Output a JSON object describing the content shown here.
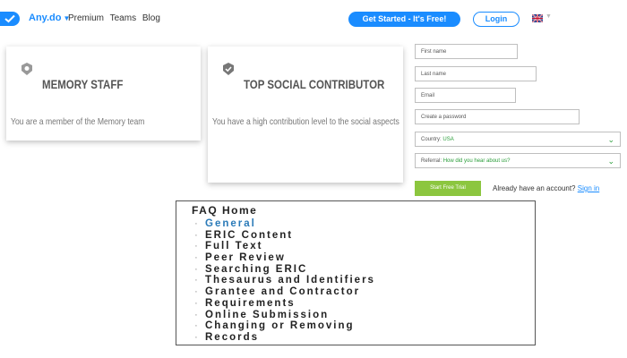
{
  "header": {
    "brand": "Any.do",
    "nav_links": [
      "Premium",
      "Teams",
      "Blog"
    ],
    "get_started_label": "Get Started - It's Free!",
    "login_label": "Login",
    "accent_color": "#1a8cff"
  },
  "badges": [
    {
      "icon": "brain-badge-icon",
      "title": "MEMORY STAFF",
      "description": "You are a member of the Memory team"
    },
    {
      "icon": "shield-check-icon",
      "title": "TOP SOCIAL CONTRIBUTOR",
      "description": "You have a high contribution level to the social aspects"
    }
  ],
  "signup": {
    "first_name_placeholder": "First name",
    "last_name_placeholder": "Last name",
    "email_placeholder": "Email",
    "password_placeholder": "Create a password",
    "country_label": "Country:",
    "country_value": "USA",
    "referral_label": "Referral:",
    "referral_value": "How did you hear about us?",
    "start_button_label": "Start Free Trial",
    "have_account_text": "Already have an account?",
    "signin_label": "Sign in",
    "button_color": "#8cc63f"
  },
  "faq": {
    "title": "FAQ Home",
    "items": [
      "General",
      "ERIC Content",
      "Full Text",
      "Peer Review",
      "Searching ERIC",
      "Thesaurus and Identifiers",
      "Grantee and Contractor",
      "Requirements",
      "Online Submission",
      "Changing or Removing",
      "Records"
    ],
    "active_index": 0
  }
}
